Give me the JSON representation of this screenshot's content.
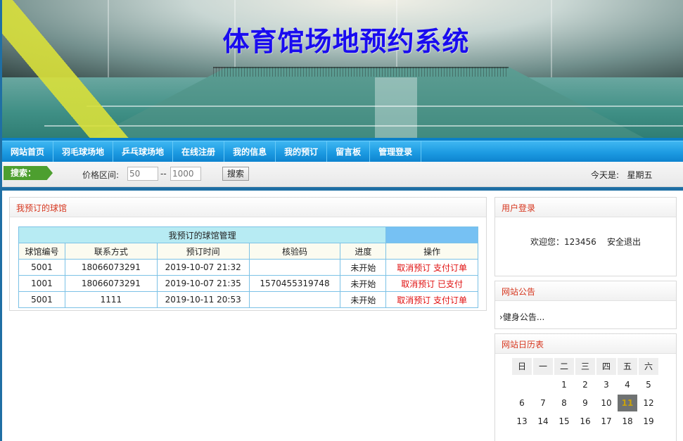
{
  "banner": {
    "title": "体育馆场地预约系统"
  },
  "nav": [
    "网站首页",
    "羽毛球场地",
    "乒乓球场地",
    "在线注册",
    "我的信息",
    "我的预订",
    "留言板",
    "管理登录"
  ],
  "search": {
    "tag": "搜索：",
    "price_label": "价格区间:",
    "min_placeholder": "50",
    "separator": "--",
    "max_placeholder": "1000",
    "button": "搜索"
  },
  "today": {
    "label": "今天是:",
    "weekday": "星期五"
  },
  "main": {
    "heading": "我预订的球馆",
    "table_caption": "我预订的球馆管理",
    "columns": [
      "球馆编号",
      "联系方式",
      "预订时间",
      "核验码",
      "进度",
      "操作"
    ],
    "rows": [
      {
        "venue_id": "5001",
        "contact": "18066073291",
        "time": "2019-10-07 21:32",
        "code": "",
        "status": "未开始",
        "action1": "取消预订",
        "action2": "支付订单"
      },
      {
        "venue_id": "1001",
        "contact": "18066073291",
        "time": "2019-10-07 21:35",
        "code": "1570455319748",
        "status": "未开始",
        "action1": "取消预订",
        "action2": "已支付"
      },
      {
        "venue_id": "5001",
        "contact": "1111",
        "time": "2019-10-11 20:53",
        "code": "",
        "status": "未开始",
        "action1": "取消预订",
        "action2": "支付订单"
      }
    ]
  },
  "login": {
    "heading": "用户登录",
    "welcome": "欢迎您：123456",
    "logout": "安全退出"
  },
  "notice": {
    "heading": "网站公告",
    "item": "健身公告..."
  },
  "calendar": {
    "heading": "网站日历表",
    "weekdays": [
      "日",
      "一",
      "二",
      "三",
      "四",
      "五",
      "六"
    ],
    "weeks": [
      [
        "",
        "",
        "1",
        "2",
        "3",
        "4",
        "5"
      ],
      [
        "6",
        "7",
        "8",
        "9",
        "10",
        "11",
        "12"
      ],
      [
        "13",
        "14",
        "15",
        "16",
        "17",
        "18",
        "19"
      ]
    ],
    "today": "11"
  },
  "colors": {
    "nav_blue": "#1a98e0",
    "title_blue": "#1a0cf0",
    "heading_red": "#d6361e",
    "action_red": "#e01010",
    "sep_blue": "#1f6fa4"
  }
}
